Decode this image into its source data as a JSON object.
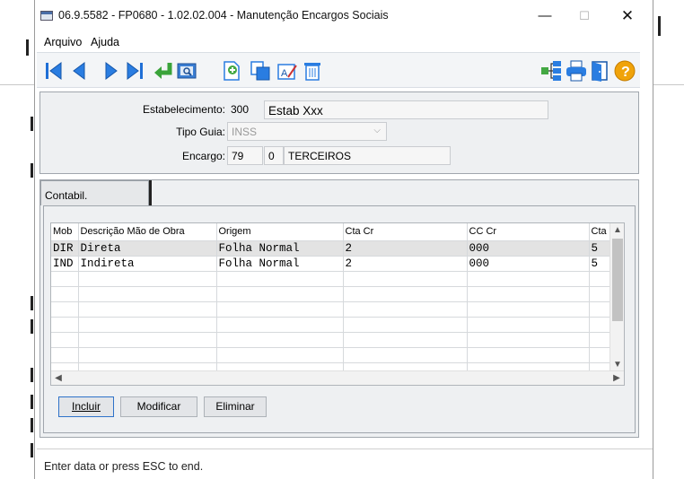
{
  "window": {
    "title": "06.9.5582 - FP0680 - 1.02.02.004 - Manutenção Encargos Sociais",
    "minimize_glyph": "—",
    "maximize_glyph": "☐",
    "close_glyph": "✕"
  },
  "menu": {
    "items": [
      "Arquivo",
      "Ajuda"
    ]
  },
  "toolbar": {
    "left_icons": [
      "first-record-icon",
      "previous-record-icon",
      "next-record-icon",
      "last-record-icon",
      "return-icon",
      "search-zoom-icon",
      "add-document-icon",
      "copy-icon",
      "edit-text-icon",
      "delete-trash-icon"
    ],
    "right_icons": [
      "tree-structure-icon",
      "print-icon",
      "exit-door-icon",
      "help-icon"
    ]
  },
  "form": {
    "estabelecimento_label": "Estabelecimento:",
    "estabelecimento_code": "300",
    "estabelecimento_name": "Estab Xxx",
    "tipo_guia_label": "Tipo Guia:",
    "tipo_guia_value": "INSS",
    "encargo_label": "Encargo:",
    "encargo_code": "79",
    "encargo_seq": "0",
    "encargo_name": "TERCEIROS"
  },
  "tabs": [
    "Contabil."
  ],
  "grid": {
    "columns": [
      "Mob",
      "Descrição Mão de Obra",
      "Origem",
      "Cta Cr",
      "CC Cr",
      "Cta"
    ],
    "rows": [
      [
        "DIR",
        "Direta",
        "Folha Normal",
        "2",
        "000",
        "5"
      ],
      [
        "IND",
        "Indireta",
        "Folha Normal",
        "2",
        "000",
        "5"
      ]
    ]
  },
  "buttons": {
    "incluir": "Incluir",
    "modificar": "Modificar",
    "eliminar": "Eliminar"
  },
  "status": "Enter data or press ESC to end.",
  "colors": {
    "toolbar_icon_blue": "#1f6fd6",
    "selected_row": "#e3e3e3",
    "help_icon": "#f0a30a"
  }
}
